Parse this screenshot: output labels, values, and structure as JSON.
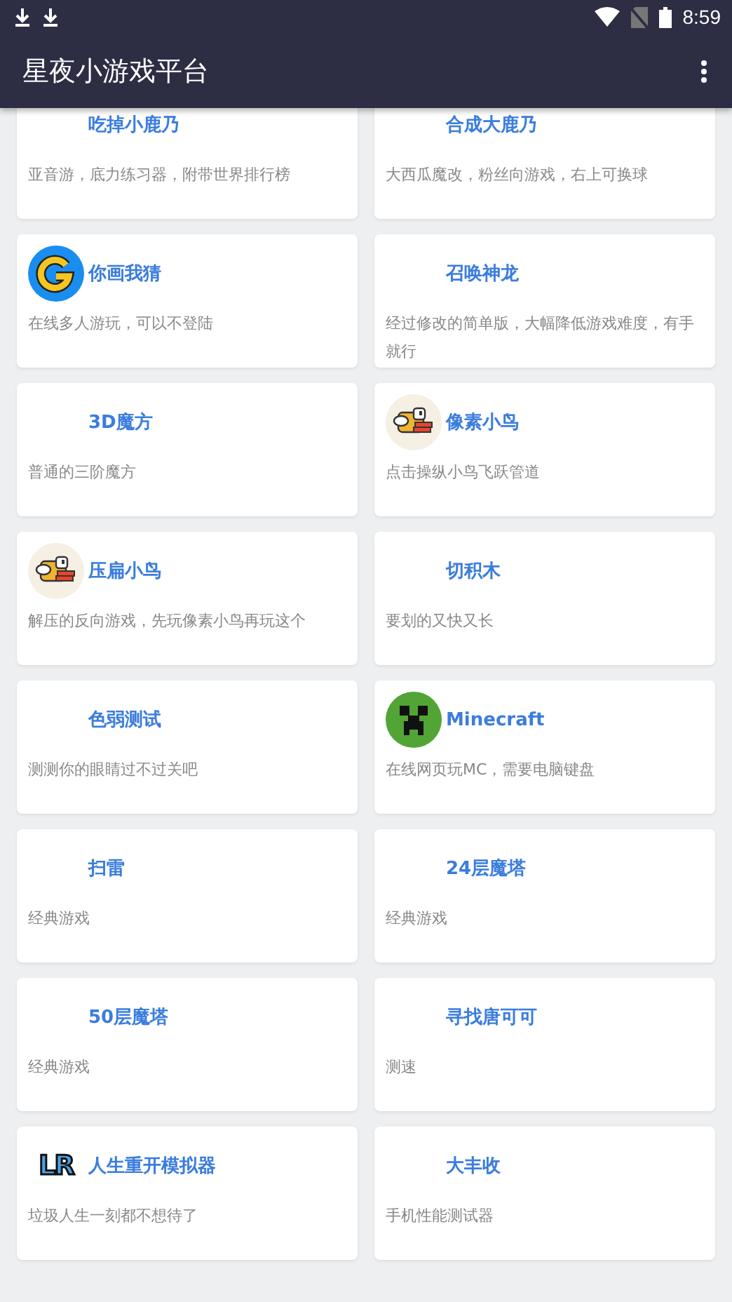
{
  "status_bar": {
    "time": "8:59"
  },
  "app_bar": {
    "title": "星夜小游戏平台"
  },
  "games": [
    {
      "title": "吃掉小鹿乃",
      "description": "亚音游，底力练习器，附带世界排行榜",
      "kind": "plain"
    },
    {
      "title": "合成大鹿乃",
      "description": "大西瓜魔改，粉丝向游戏，右上可换球",
      "kind": "plain"
    },
    {
      "title": "你画我猜",
      "description": "在线多人游玩，可以不登陆",
      "kind": "glogo"
    },
    {
      "title": "召唤神龙",
      "description": "经过修改的简单版，大幅降低游戏难度，有手就行",
      "kind": "plain"
    },
    {
      "title": "3D魔方",
      "description": "普通的三阶魔方",
      "kind": "plain"
    },
    {
      "title": "像素小鸟",
      "description": "点击操纵小鸟飞跃管道",
      "kind": "bird"
    },
    {
      "title": "压扁小鸟",
      "description": "解压的反向游戏，先玩像素小鸟再玩这个",
      "kind": "bird"
    },
    {
      "title": "切积木",
      "description": "要划的又快又长",
      "kind": "plain"
    },
    {
      "title": "色弱测试",
      "description": "测测你的眼睛过不过关吧",
      "kind": "plain"
    },
    {
      "title": "Minecraft",
      "description": "在线网页玩MC，需要电脑键盘",
      "kind": "creeper"
    },
    {
      "title": "扫雷",
      "description": "经典游戏",
      "kind": "plain"
    },
    {
      "title": "24层魔塔",
      "description": "经典游戏",
      "kind": "plain"
    },
    {
      "title": "50层魔塔",
      "description": "经典游戏",
      "kind": "plain"
    },
    {
      "title": "寻找唐可可",
      "description": "测速",
      "kind": "plain"
    },
    {
      "title": "人生重开模拟器",
      "description": "垃圾人生一刻都不想待了",
      "kind": "lettered",
      "logo_text": "LR"
    },
    {
      "title": "大丰收",
      "description": "手机性能测试器",
      "kind": "plain"
    }
  ]
}
